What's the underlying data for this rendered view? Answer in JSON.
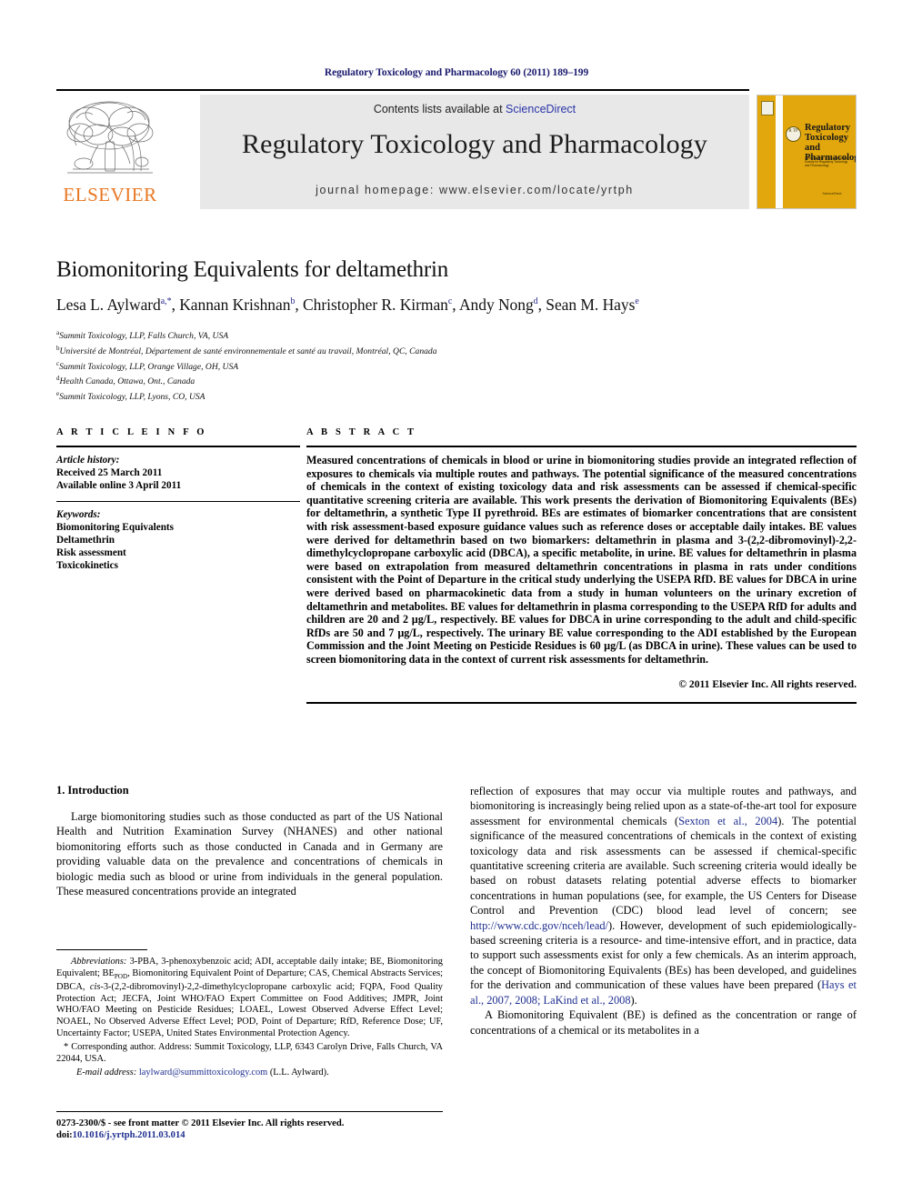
{
  "running_head": "Regulatory Toxicology and Pharmacology 60 (2011) 189–199",
  "masthead": {
    "contents_prefix": "Contents lists available at ",
    "sciencedirect": "ScienceDirect",
    "journal_title": "Regulatory Toxicology and Pharmacology",
    "homepage": "journal homepage: www.elsevier.com/locate/yrtph",
    "publisher": "ELSEVIER",
    "cover": {
      "title_line1": "Regulatory",
      "title_line2": "Toxicology and",
      "title_line3": "Pharmacology",
      "badge": "R TP",
      "subtitle": "Official Journal of the International Society for Regulatory Toxicology and Pharmacology",
      "footer": "ScienceDirect"
    },
    "accent_blue": "#2b35a8",
    "elsevier_orange": "#E87722",
    "cover_yellow": "#e2a70d"
  },
  "title": "Biomonitoring Equivalents for deltamethrin",
  "authors": [
    {
      "name": "Lesa L. Aylward",
      "marks": "a,*"
    },
    {
      "name": "Kannan Krishnan",
      "marks": "b"
    },
    {
      "name": "Christopher R. Kirman",
      "marks": "c"
    },
    {
      "name": "Andy Nong",
      "marks": "d"
    },
    {
      "name": "Sean M. Hays",
      "marks": "e"
    }
  ],
  "affiliations": [
    {
      "mark": "a",
      "text": "Summit Toxicology, LLP, Falls Church, VA, USA"
    },
    {
      "mark": "b",
      "text": "Université de Montréal, Département de santé environnementale et santé au travail, Montréal, QC, Canada"
    },
    {
      "mark": "c",
      "text": "Summit Toxicology, LLP, Orange Village, OH, USA"
    },
    {
      "mark": "d",
      "text": "Health Canada, Ottawa, Ont., Canada"
    },
    {
      "mark": "e",
      "text": "Summit Toxicology, LLP, Lyons, CO, USA"
    }
  ],
  "article_info": {
    "heading": "A R T I C L E   I N F O",
    "history_label": "Article history:",
    "received": "Received 25 March 2011",
    "available": "Available online 3 April 2011",
    "keywords_label": "Keywords:",
    "keywords": [
      "Biomonitoring Equivalents",
      "Deltamethrin",
      "Risk assessment",
      "Toxicokinetics"
    ]
  },
  "abstract": {
    "heading": "A B S T R A C T",
    "text": "Measured concentrations of chemicals in blood or urine in biomonitoring studies provide an integrated reflection of exposures to chemicals via multiple routes and pathways. The potential significance of the measured concentrations of chemicals in the context of existing toxicology data and risk assessments can be assessed if chemical-specific quantitative screening criteria are available. This work presents the derivation of Biomonitoring Equivalents (BEs) for deltamethrin, a synthetic Type II pyrethroid. BEs are estimates of biomarker concentrations that are consistent with risk assessment-based exposure guidance values such as reference doses or acceptable daily intakes. BE values were derived for deltamethrin based on two biomarkers: deltamethrin in plasma and 3-(2,2-dibromovinyl)-2,2-dimethylcyclopropane carboxylic acid (DBCA), a specific metabolite, in urine. BE values for deltamethrin in plasma were based on extrapolation from measured deltamethrin concentrations in plasma in rats under conditions consistent with the Point of Departure in the critical study underlying the USEPA RfD. BE values for DBCA in urine were derived based on pharmacokinetic data from a study in human volunteers on the urinary excretion of deltamethrin and metabolites. BE values for deltamethrin in plasma corresponding to the USEPA RfD for adults and children are 20 and 2 µg/L, respectively. BE values for DBCA in urine corresponding to the adult and child-specific RfDs are 50 and 7 µg/L, respectively. The urinary BE value corresponding to the ADI established by the European Commission and the Joint Meeting on Pesticide Residues is 60 µg/L (as DBCA in urine). These values can be used to screen biomonitoring data in the context of current risk assessments for deltamethrin.",
    "copyright": "© 2011 Elsevier Inc. All rights reserved."
  },
  "intro": {
    "heading": "1. Introduction",
    "left_para": "Large biomonitoring studies such as those conducted as part of the US National Health and Nutrition Examination Survey (NHANES) and other national biomonitoring efforts such as those conducted in Canada and in Germany are providing valuable data on the prevalence and concentrations of chemicals in biologic media such as blood or urine from individuals in the general population. These measured concentrations provide an integrated",
    "right_para_1a": "reflection of exposures that may occur via multiple routes and pathways, and biomonitoring is increasingly being relied upon as a state-of-the-art tool for exposure assessment for environmental chemicals (",
    "right_cite_1": "Sexton et al., 2004",
    "right_para_1b": "). The potential significance of the measured concentrations of chemicals in the context of existing toxicology data and risk assessments can be assessed if chemical-specific quantitative screening criteria are available. Such screening criteria would ideally be based on robust datasets relating potential adverse effects to biomarker concentrations in human populations (see, for example, the US Centers for Disease Control and Prevention (CDC) blood lead level of concern; see ",
    "right_cite_2": "http://www.cdc.gov/nceh/lead/",
    "right_para_1c": "). However, development of such epidemiologically-based screening criteria is a resource- and time-intensive effort, and in practice, data to support such assessments exist for only a few chemicals. As an interim approach, the concept of Biomonitoring Equivalents (BEs) has been developed, and guidelines for the derivation and communication of these values have been prepared (",
    "right_cite_3": "Hays et al., 2007, 2008; LaKind et al., 2008",
    "right_para_1d": ").",
    "right_para_2": "A Biomonitoring Equivalent (BE) is defined as the concentration or range of concentrations of a chemical or its metabolites in a"
  },
  "footnotes": {
    "abbrev_label": "Abbreviations:",
    "abbrev_text_a": " 3-PBA, 3-phenoxybenzoic acid; ADI, acceptable daily intake; BE, Biomonitoring Equivalent; BE",
    "abbrev_sub": "POD",
    "abbrev_text_b": ", Biomonitoring Equivalent Point of Departure; CAS, Chemical Abstracts Services; DBCA, ",
    "abbrev_italic": "cis",
    "abbrev_text_c": "-3-(2,2-dibromovinyl)-2,2-dimethylcyclopropane carboxylic acid; FQPA, Food Quality Protection Act; JECFA, Joint WHO/FAO Expert Committee on Food Additives; JMPR, Joint WHO/FAO Meeting on Pesticide Residues; LOAEL, Lowest Observed Adverse Effect Level; NOAEL, No Observed Adverse Effect Level; POD, Point of Departure; RfD, Reference Dose; UF, Uncertainty Factor; USEPA, United States Environmental Protection Agency.",
    "corresponding": "* Corresponding author. Address: Summit Toxicology, LLP, 6343 Carolyn Drive, Falls Church, VA 22044, USA.",
    "email_label": "E-mail address:",
    "email": "laylward@summittoxicology.com",
    "email_suffix": " (L.L. Aylward)."
  },
  "footer": {
    "issn": "0273-2300/$ - see front matter © 2011 Elsevier Inc. All rights reserved.",
    "doi_label": "doi:",
    "doi": "10.1016/j.yrtph.2011.03.014"
  }
}
